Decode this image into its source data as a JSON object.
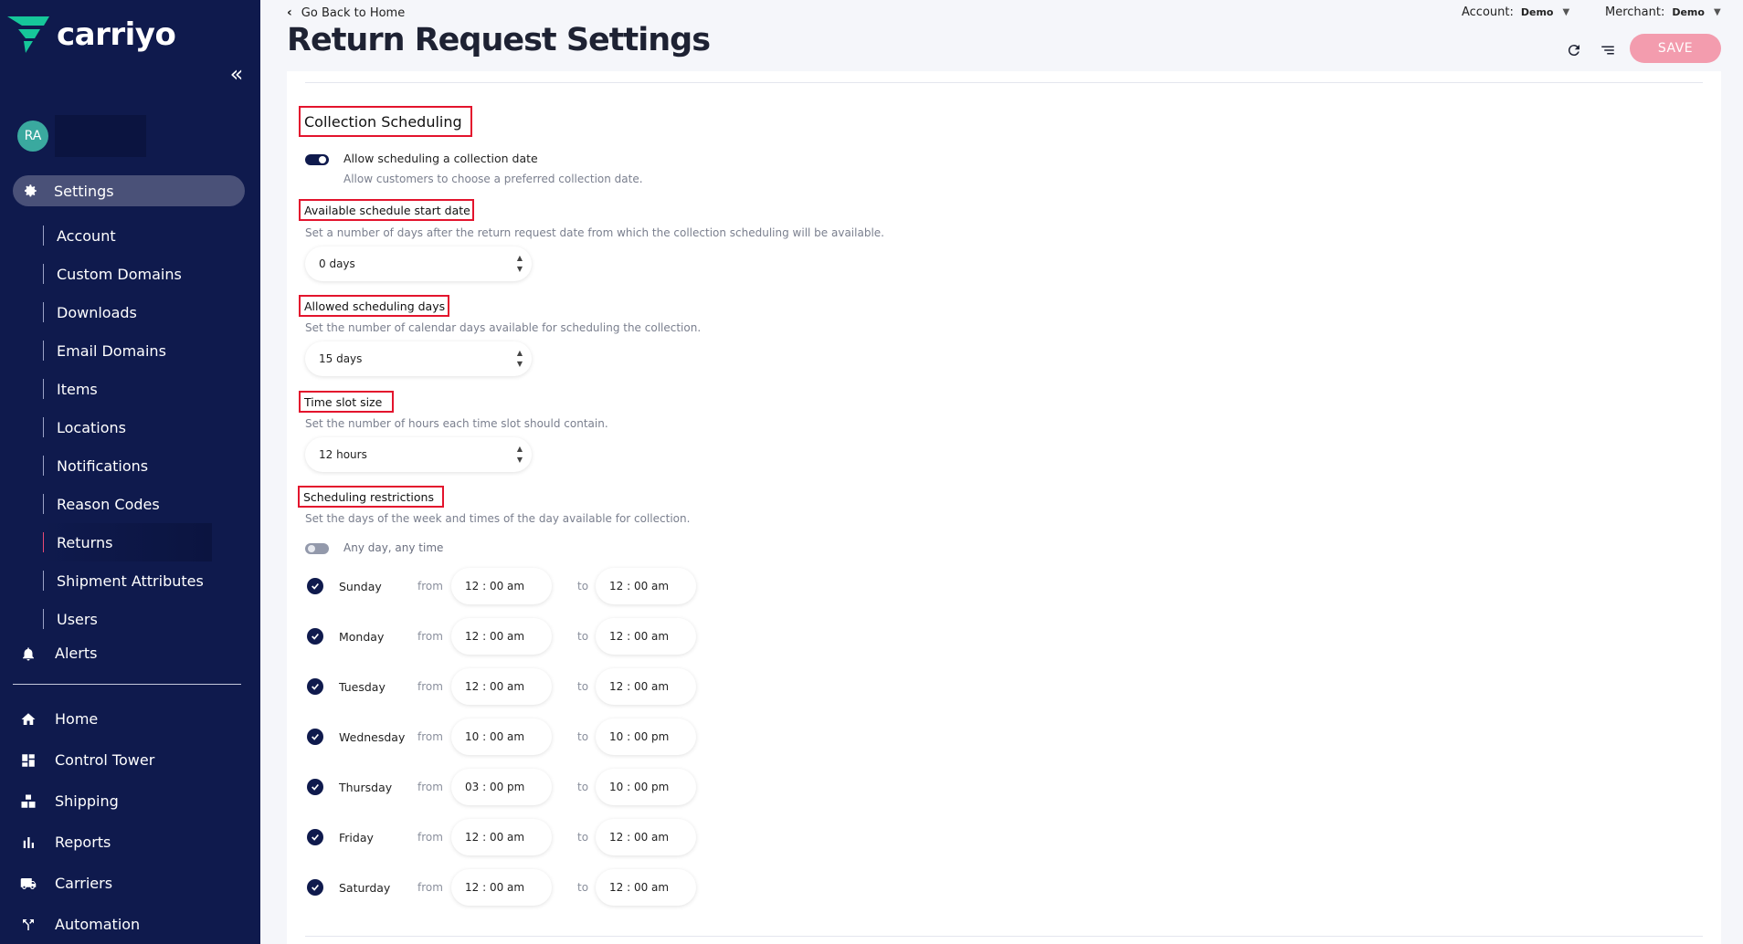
{
  "brand": {
    "name": "carriyo",
    "accent": "#16c79a",
    "sidebar_bg": "#0f1a4d",
    "highlight": "#e3142d"
  },
  "sidebar": {
    "collapse_icon": "double-chevron-left-icon",
    "user_initials": "RA",
    "settings": {
      "label": "Settings",
      "icon": "gear-icon"
    },
    "sub_items": [
      {
        "label": "Account"
      },
      {
        "label": "Custom Domains"
      },
      {
        "label": "Downloads"
      },
      {
        "label": "Email Domains"
      },
      {
        "label": "Items"
      },
      {
        "label": "Locations"
      },
      {
        "label": "Notifications"
      },
      {
        "label": "Reason Codes"
      },
      {
        "label": "Returns"
      },
      {
        "label": "Shipment Attributes"
      },
      {
        "label": "Users"
      }
    ],
    "alerts": {
      "label": "Alerts",
      "icon": "bell-icon"
    },
    "main_items": [
      {
        "label": "Home",
        "icon": "home-icon"
      },
      {
        "label": "Control Tower",
        "icon": "dashboard-icon"
      },
      {
        "label": "Shipping",
        "icon": "boxes-icon"
      },
      {
        "label": "Reports",
        "icon": "bar-chart-icon"
      },
      {
        "label": "Carriers",
        "icon": "truck-icon"
      },
      {
        "label": "Automation",
        "icon": "fork-icon"
      }
    ]
  },
  "header": {
    "back_label": "Go Back to Home",
    "title": "Return Request Settings",
    "account_label": "Account:",
    "account_value": "Demo",
    "merchant_label": "Merchant:",
    "merchant_value": "Demo",
    "save_label": "SAVE"
  },
  "collection": {
    "section_title": "Collection Scheduling",
    "allow_toggle_label": "Allow scheduling a collection date",
    "allow_toggle_desc": "Allow customers to choose a preferred collection date.",
    "allow_toggle_on": true,
    "start_date": {
      "label": "Available schedule start date",
      "desc": "Set a number of days after the return request date from which the collection scheduling will be available.",
      "value": "0 days"
    },
    "allowed_days": {
      "label": "Allowed scheduling days",
      "desc": "Set the number of calendar days available for scheduling the collection.",
      "value": "15 days"
    },
    "slot_size": {
      "label": "Time slot size",
      "desc": "Set the number of hours each time slot should contain.",
      "value": "12 hours"
    },
    "restrictions": {
      "label": "Scheduling restrictions",
      "desc": "Set the days of the week and times of the day available for collection.",
      "any_time_label": "Any day, any time",
      "any_time_on": false,
      "from_label": "from",
      "to_label": "to",
      "days": [
        {
          "name": "Sunday",
          "from": "12 : 00  am",
          "to": "12 : 00  am"
        },
        {
          "name": "Monday",
          "from": "12 : 00  am",
          "to": "12 : 00  am"
        },
        {
          "name": "Tuesday",
          "from": "12 : 00  am",
          "to": "12 : 00  am"
        },
        {
          "name": "Wednesday",
          "from": "10 : 00  am",
          "to": "10 : 00  pm"
        },
        {
          "name": "Thursday",
          "from": "03 : 00  pm",
          "to": "10 : 00  pm"
        },
        {
          "name": "Friday",
          "from": "12 : 00  am",
          "to": "12 : 00  am"
        },
        {
          "name": "Saturday",
          "from": "12 : 00  am",
          "to": "12 : 00  am"
        }
      ]
    }
  }
}
